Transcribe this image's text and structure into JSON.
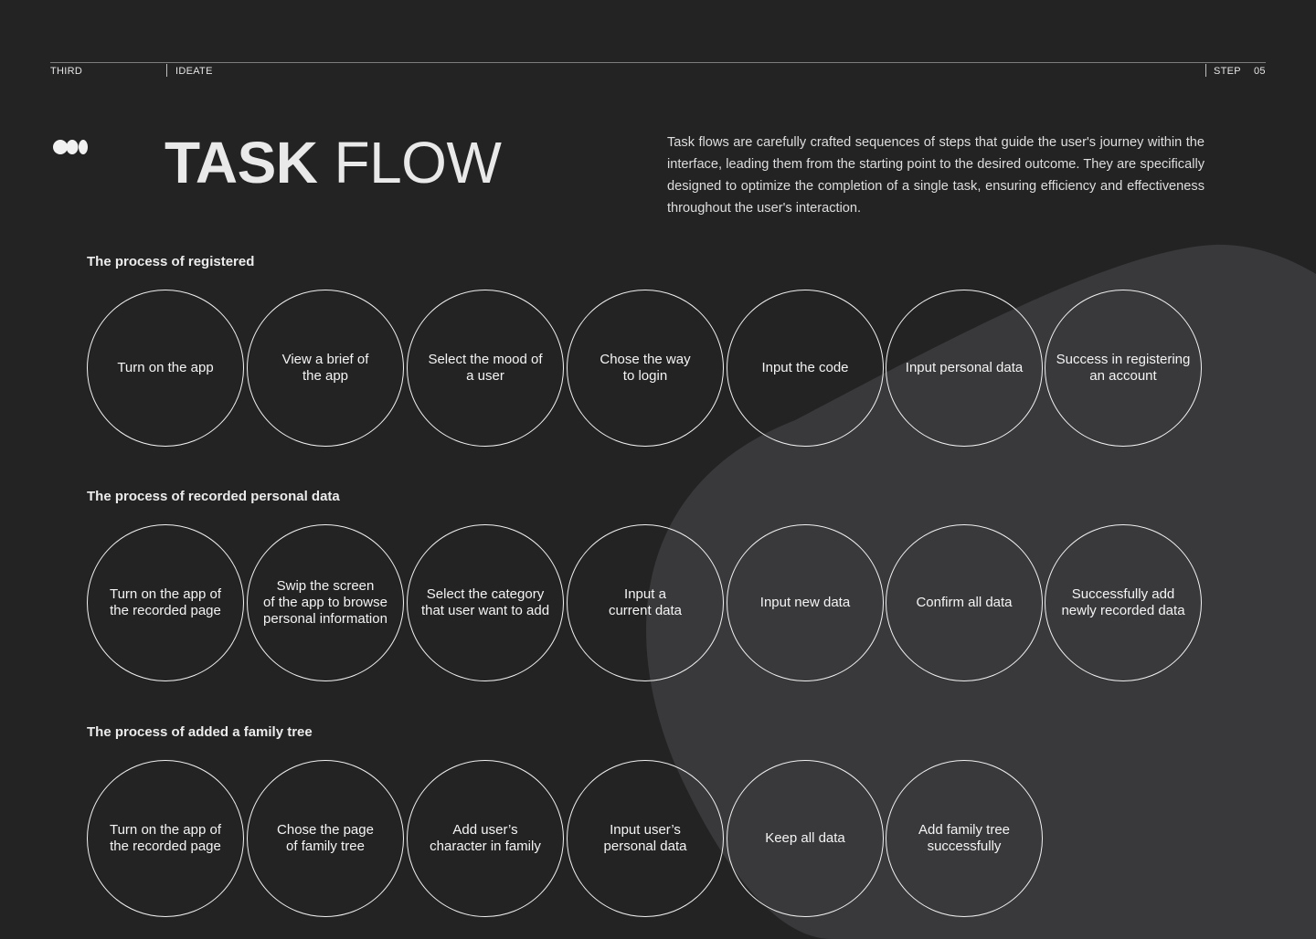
{
  "header": {
    "left": "THIRD",
    "section": "IDEATE",
    "step_label": "STEP",
    "step_number": "05"
  },
  "title": {
    "bold": "TASK",
    "light": "FLOW"
  },
  "description": "Task flows are carefully crafted sequences of steps that guide the user's journey within the interface, leading them from the starting point to the desired outcome. They are specifically designed to optimize the completion of a single task, ensuring efficiency and effectiveness throughout the user's interaction.",
  "processes": [
    {
      "title": "The process of registered",
      "steps": [
        "Turn on the app",
        "View a brief of\nthe app",
        "Select the mood of\na user",
        "Chose the way\nto login",
        "Input the code",
        "Input personal data",
        "Success in registering\nan account"
      ]
    },
    {
      "title": "The process of recorded personal data",
      "steps": [
        "Turn on the app of\nthe recorded page",
        "Swip the screen\nof the app to browse\npersonal information",
        "Select the category\nthat user want to add",
        "Input a\ncurrent data",
        "Input new data",
        "Confirm all data",
        "Successfully add\nnewly recorded data"
      ]
    },
    {
      "title": "The process of added a family tree",
      "steps": [
        "Turn on the app of\nthe recorded page",
        "Chose the page\nof family tree",
        "Add user’s\ncharacter in family",
        "Input user’s\npersonal data",
        "Keep all data",
        "Add family tree\nsuccessfully"
      ]
    }
  ]
}
